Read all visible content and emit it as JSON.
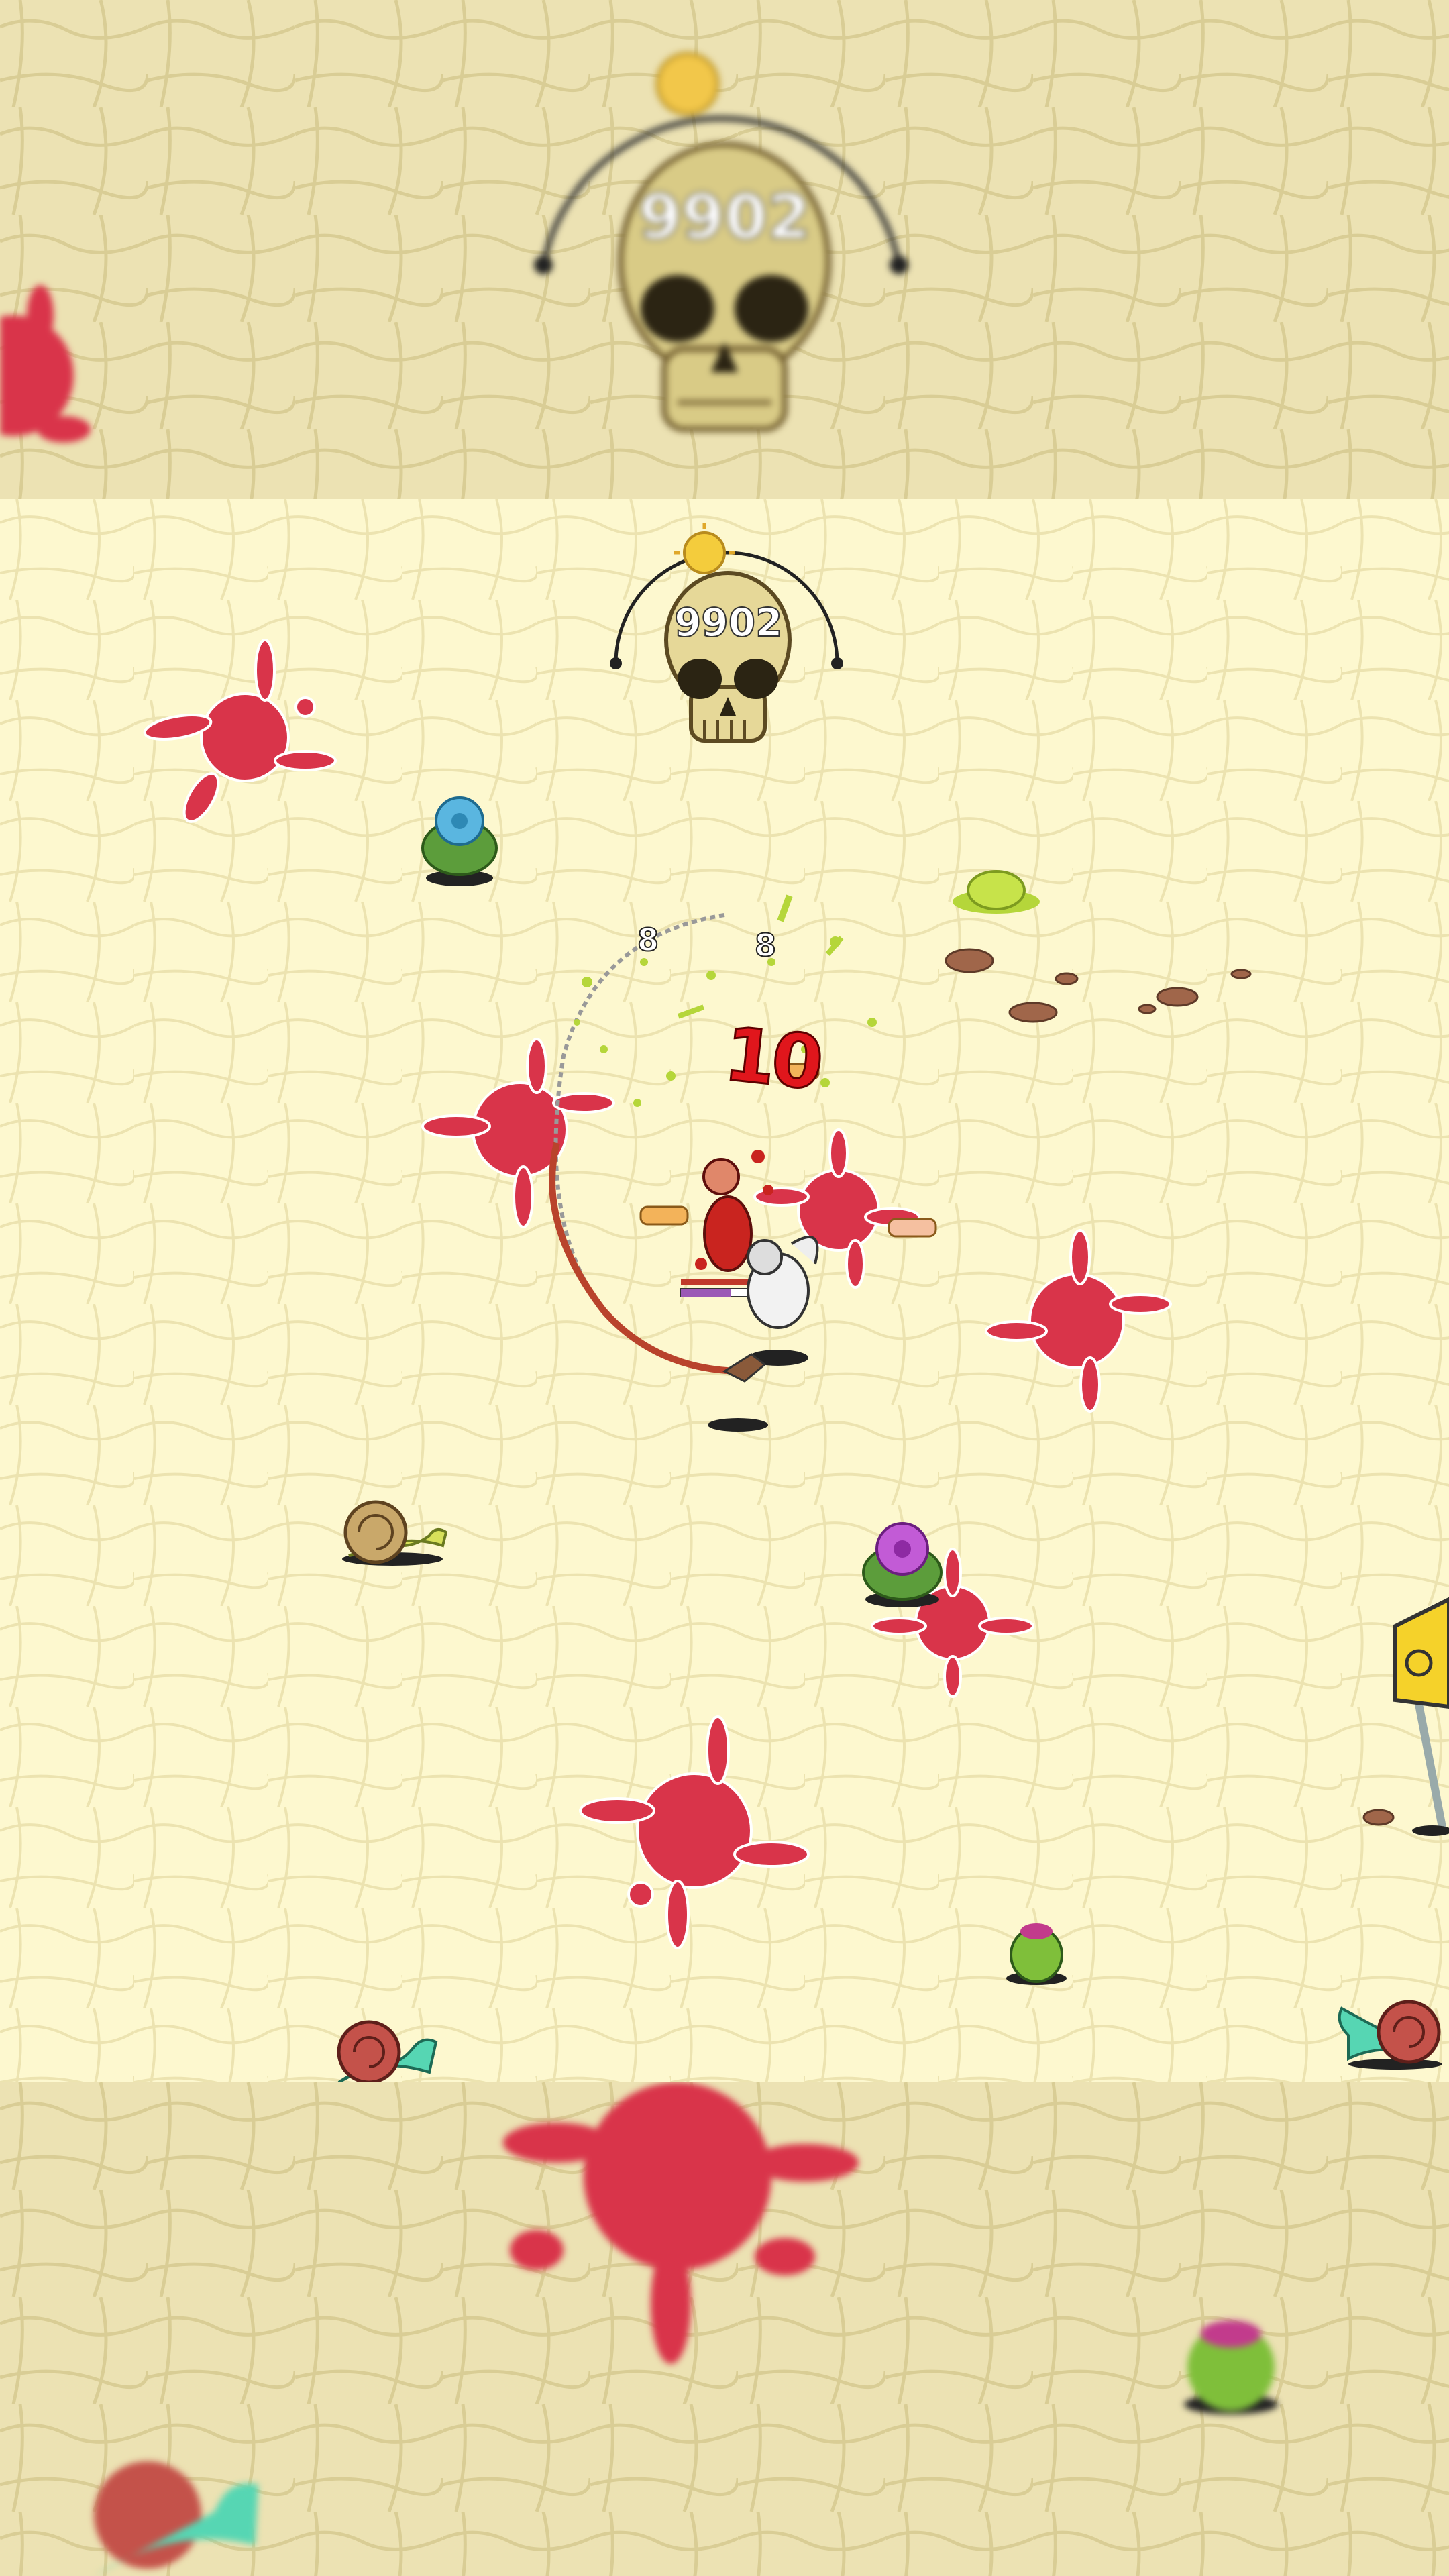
{
  "hud": {
    "skull_icon": "skull-icon",
    "kill_count": "9902",
    "sun_icon": "sun-icon",
    "progress_arc": "day-night-arc"
  },
  "combat_text": {
    "hit_left": "8",
    "hit_right": "8",
    "big_damage": "10"
  },
  "colors": {
    "ground": "#fdf8cf",
    "ground_blurred": "#ece2b3",
    "splat": "#d9344a",
    "acid": "#b5d63a",
    "health_bar": "#c0392b",
    "xp_bar": "#9b59b6"
  },
  "entities": [
    "blue-flower",
    "pink-flower",
    "cactus",
    "snail",
    "slime",
    "rocks",
    "biohazard-sign",
    "player",
    "enemy"
  ]
}
